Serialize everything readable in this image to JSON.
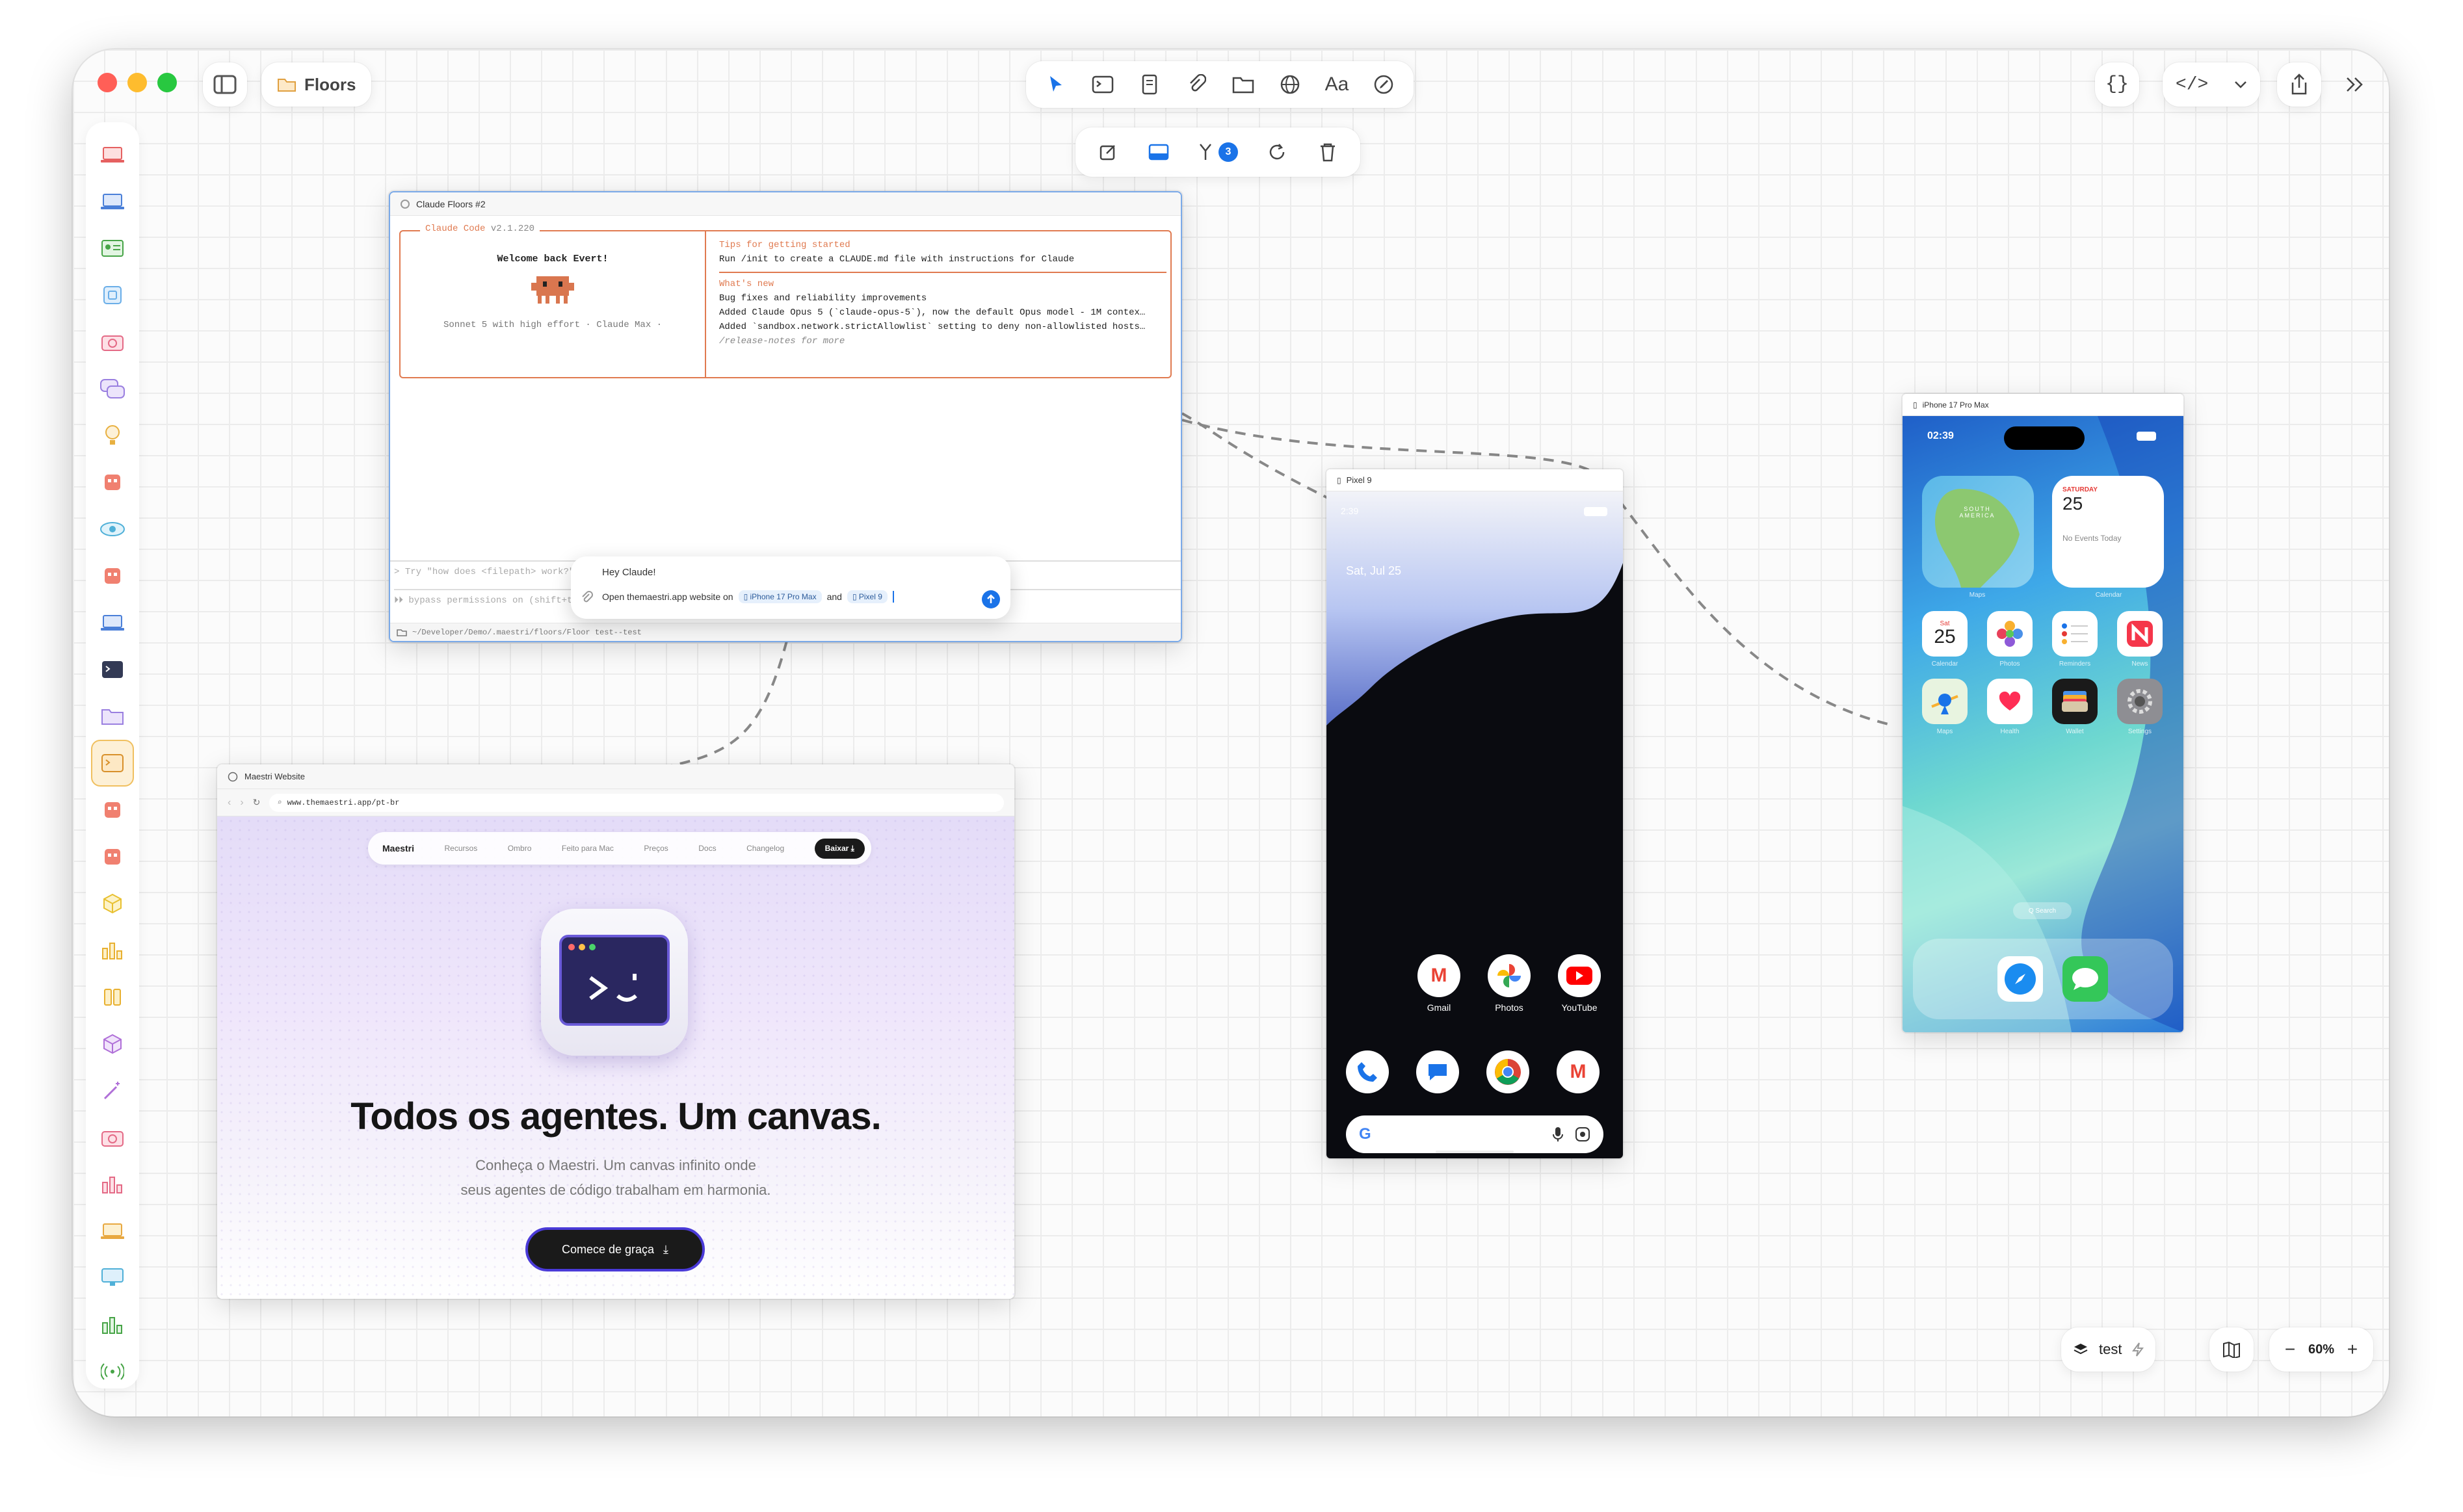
{
  "window": {
    "title": "Floors"
  },
  "topbar": {
    "font_tool": "Aa"
  },
  "float_toolbar": {
    "badge": "3"
  },
  "terminal": {
    "title": "Claude Floors #2",
    "header": "Claude Code",
    "version": "v2.1.220",
    "welcome": "Welcome back Evert!",
    "model_line": "Sonnet 5 with high effort · Claude Max ·",
    "tips_title": "Tips for getting started",
    "tips_text": "Run /init to create a CLAUDE.md file with instructions for Claude",
    "whats_new_title": "What's new",
    "news": [
      "Bug fixes and reliability improvements",
      "Added Claude Opus 5 (`claude-opus-5`), now the default Opus model - 1M contex…",
      "Added `sandbox.network.strictAllowlist` setting to deny non-allowlisted hosts…"
    ],
    "release_notes": "/release-notes for more",
    "prompt_hint": "Try \"how does <filepath> work?\"",
    "bypass_hint": "⏵⏵ bypass permissions on (shift+tab to cycle)",
    "path": "~/Developer/Demo/.maestri/floors/Floor test--test"
  },
  "chat": {
    "greeting": "Hey Claude!",
    "message_prefix": "Open themaestri.app website on",
    "chip1": "iPhone 17 Pro Max",
    "and": "and",
    "chip2": "Pixel 9"
  },
  "browser": {
    "title": "Maestri Website",
    "url": "www.themaestri.app/pt-br",
    "nav_brand": "Maestri",
    "nav": [
      "Recursos",
      "Ombro",
      "Feito para Mac",
      "Preços",
      "Docs",
      "Changelog"
    ],
    "download": "Baixar",
    "headline": "Todos os agentes. Um canvas.",
    "sub1": "Conheça o Maestri. Um canvas infinito onde",
    "sub2": "seus agentes de código trabalham em harmonia.",
    "cta": "Comece de graça"
  },
  "pixel": {
    "title": "Pixel 9",
    "time": "2:39",
    "date": "Sat, Jul 25",
    "apps_row1": [
      "Gmail",
      "Photos",
      "YouTube"
    ]
  },
  "iphone": {
    "title": "iPhone 17 Pro Max",
    "time": "02:39",
    "map_label": "SOUTH AMERICA",
    "maps_label": "Maps",
    "cal_day": "SATURDAY",
    "cal_date": "25",
    "cal_events": "No Events Today",
    "cal_widget_label": "Calendar",
    "cal_icon_day": "Sat",
    "cal_icon_date": "25",
    "apps_row1": [
      "Calendar",
      "Photos",
      "Reminders",
      "News"
    ],
    "apps_row2": [
      "Maps",
      "Health",
      "Wallet",
      "Settings"
    ],
    "search": "Q Search"
  },
  "bottombar": {
    "floor": "test",
    "zoom": "60%"
  }
}
